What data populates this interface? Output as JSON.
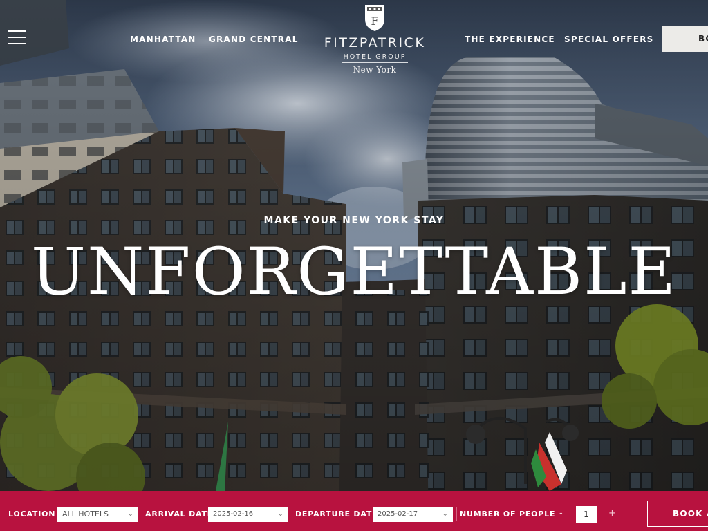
{
  "header": {
    "nav_left": [
      "MANHATTAN",
      "GRAND CENTRAL"
    ],
    "nav_right": [
      "THE EXPERIENCE",
      "SPECIAL OFFERS"
    ],
    "book_label": "BOOK"
  },
  "logo": {
    "brand": "FITZPATRICK",
    "group": "HOTEL GROUP",
    "city": "New York",
    "crest_letters": "F"
  },
  "hero": {
    "tagline": "MAKE YOUR NEW YORK STAY",
    "headline": "UNFORGETTABLE"
  },
  "booking": {
    "location_label": "LOCATION",
    "location_value": "ALL HOTELS",
    "arrival_label": "ARRIVAL DATE",
    "arrival_value": "2025-02-16",
    "departure_label": "DEPARTURE DATE",
    "departure_value": "2025-02-17",
    "people_label": "NUMBER OF PEOPLE",
    "people_minus": "-",
    "people_value": "1",
    "people_plus": "+",
    "book_label": "BOOK A"
  },
  "icons": {
    "menu": "hamburger-icon",
    "chevron": "chevron-down-icon",
    "crest": "shield-crest-icon"
  },
  "colors": {
    "accent": "#b8123f",
    "header_button": "#ecebe8",
    "text": "#ffffff"
  }
}
